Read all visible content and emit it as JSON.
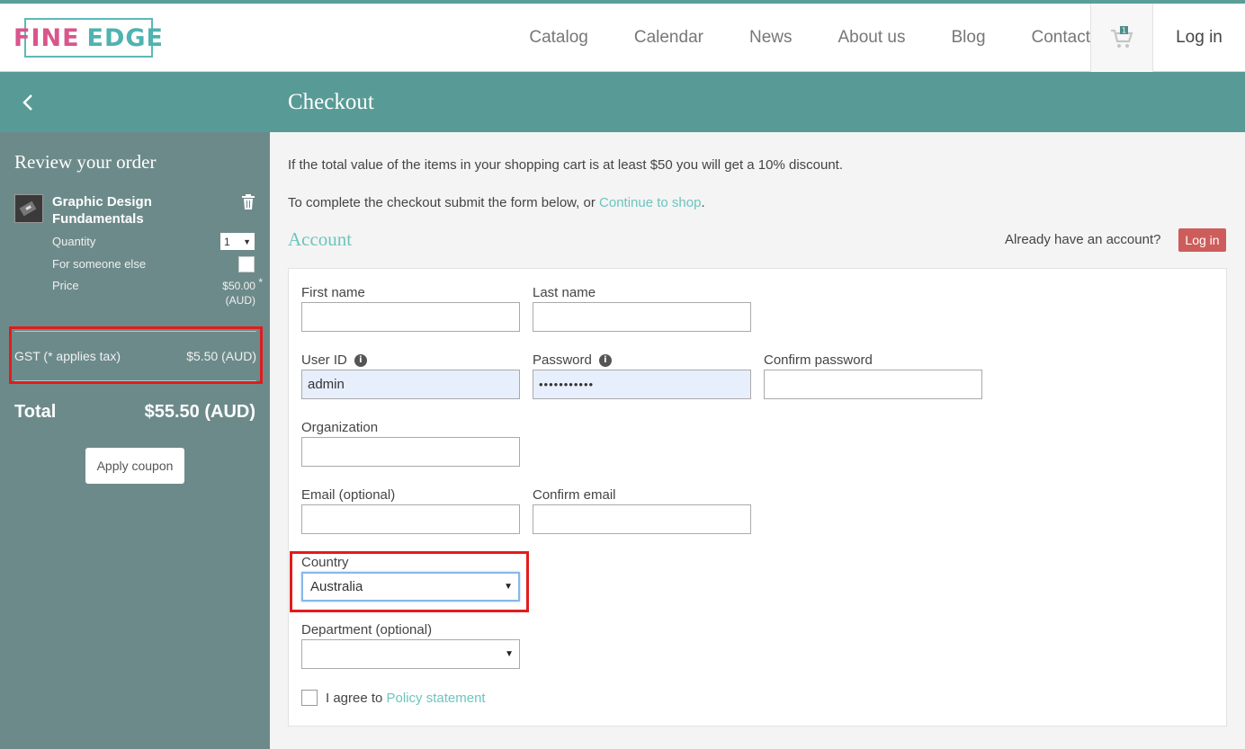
{
  "header": {
    "logo": {
      "part1": "FINE",
      "part2": "EDGE"
    },
    "nav": [
      "Catalog",
      "Calendar",
      "News",
      "About us",
      "Blog",
      "Contact"
    ],
    "cart_count": "1",
    "login_label": "Log in"
  },
  "page": {
    "title": "Checkout",
    "discount_text": "If the total value of the items in your shopping cart is at least $50 you will get a 10% discount.",
    "instruction_text": "To complete the checkout submit the form below, or ",
    "continue_link": "Continue to shop",
    "instruction_end": "."
  },
  "order": {
    "title": "Review your order",
    "item_name": "Graphic Design Fundamentals",
    "quantity_label": "Quantity",
    "quantity_value": "1",
    "someone_else_label": "For someone else",
    "price_label": "Price",
    "price_value": "$50.00",
    "price_currency": "(AUD)",
    "price_tax_marker": "*",
    "gst_label": "GST (* applies tax)",
    "gst_value": "$5.50 (AUD)",
    "total_label": "Total",
    "total_value": "$55.50 (AUD)",
    "coupon_label": "Apply coupon"
  },
  "account": {
    "title": "Account",
    "have_account": "Already have an account?",
    "login_button": "Log in",
    "fields": {
      "first_name": "First name",
      "last_name": "Last name",
      "user_id": "User ID",
      "user_id_value": "admin",
      "password": "Password",
      "password_value": "•••••••••••",
      "confirm_password": "Confirm password",
      "organization": "Organization",
      "email": "Email (optional)",
      "confirm_email": "Confirm email",
      "country": "Country",
      "country_value": "Australia",
      "department": "Department (optional)"
    },
    "agree_text": "I agree to ",
    "policy_link": "Policy statement"
  },
  "colors": {
    "accent": "#589b96",
    "link": "#6cc5be",
    "sidebar": "#6d8a8a",
    "login_button": "#cd5d5b",
    "highlight": "#e31b1b"
  }
}
